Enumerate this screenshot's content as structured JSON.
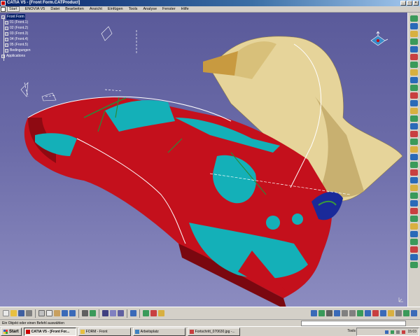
{
  "window": {
    "title": "CATIA V5 - [Front Form.CATProduct]",
    "controls": [
      "_",
      "□",
      "×"
    ]
  },
  "menubar": {
    "items": [
      "Start",
      "ENOVIA V5",
      "Datei",
      "Bearbeiten",
      "Ansicht",
      "Einfügen",
      "Tools",
      "Analyse",
      "Fenster",
      "Hilfe"
    ]
  },
  "tree": {
    "root": "Front Form",
    "children": [
      "01 (Front.1)",
      "02 (Front.2)",
      "03 (Front.3)",
      "04 (Front.4)",
      "05 (Front.5)",
      "Bedingungen",
      "Applications"
    ]
  },
  "statusbar": {
    "prompt": "Ein Objekt oder einen Befehl auswählen"
  },
  "taskbar": {
    "start_label": "Start",
    "tasks": [
      "CATIA V5 - [Front For...",
      "FORM - Front",
      "Arbeitsplatz",
      "Fortschritt_070630.jpg -..."
    ],
    "tools_label": "Tools",
    "clock": "15:03"
  },
  "colors": {
    "surface_red": "#c4101c",
    "surface_cyan": "#14b0b8",
    "surface_tan": "#e6d49a",
    "viewport_bg": "#6b6ba8"
  },
  "icons": {
    "start": "windows-flag-icon",
    "compass": "view-compass-icon"
  }
}
